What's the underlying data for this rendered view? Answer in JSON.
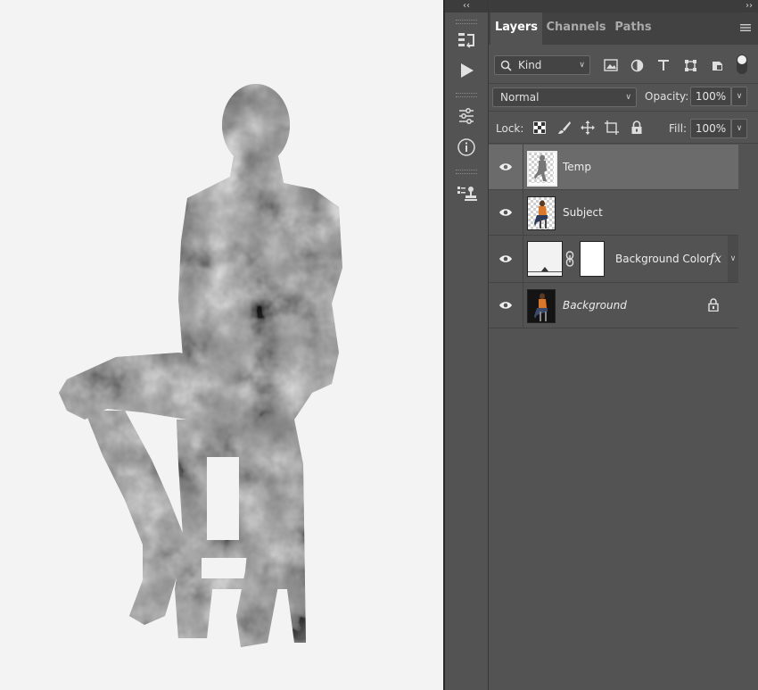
{
  "panel": {
    "tabs": [
      {
        "label": "Layers",
        "active": true
      },
      {
        "label": "Channels",
        "active": false
      },
      {
        "label": "Paths",
        "active": false
      }
    ],
    "filter": {
      "kind_label": "Kind"
    },
    "blend": {
      "mode": "Normal",
      "opacity_label": "Opacity:",
      "opacity_value": "100%"
    },
    "lock": {
      "label": "Lock:",
      "fill_label": "Fill:",
      "fill_value": "100%"
    },
    "layers": [
      {
        "name": "Temp",
        "selected": true
      },
      {
        "name": "Subject",
        "selected": false
      },
      {
        "name": "Background Color",
        "selected": false,
        "fx": "fx"
      },
      {
        "name": "Background",
        "selected": false,
        "locked": true
      }
    ]
  },
  "colors": {
    "panel_bg": "#535353",
    "tab_bar_bg": "#424242",
    "selected_layer": "#6b6b6b",
    "canvas_bg": "#f3f3f3"
  }
}
